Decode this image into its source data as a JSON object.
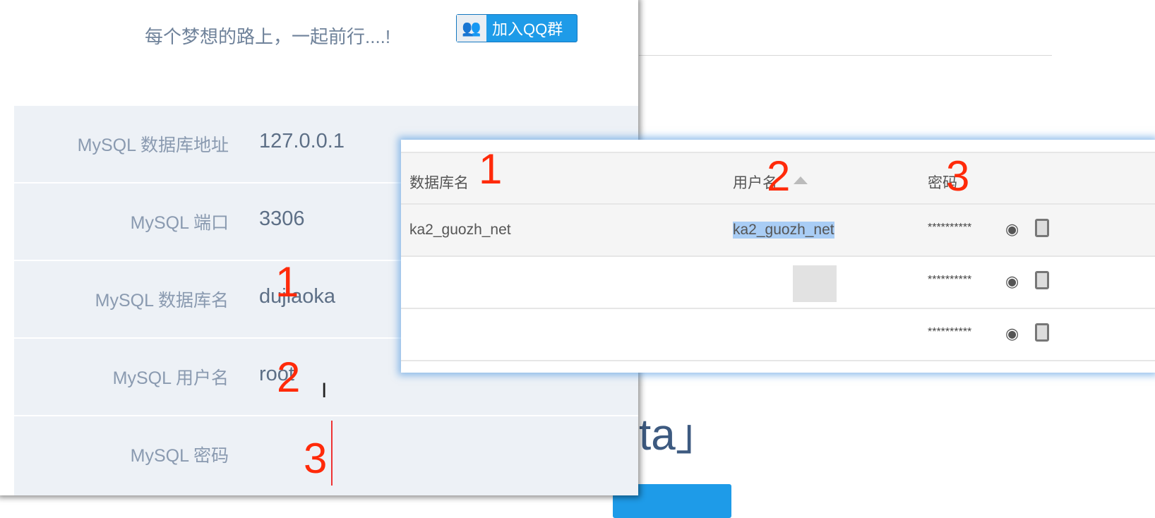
{
  "background": {
    "partial_heading": "ta」"
  },
  "header": {
    "slogan": "每个梦想的路上，一起前行....!",
    "qq_button": "加入QQ群"
  },
  "form": {
    "rows": [
      {
        "label": "MySQL 数据库地址",
        "value": "127.0.0.1"
      },
      {
        "label": "MySQL 端口",
        "value": "3306"
      },
      {
        "label": "MySQL 数据库名",
        "value": "dujiaoka"
      },
      {
        "label": "MySQL 用户名",
        "value": "root"
      },
      {
        "label": "MySQL 密码",
        "value": ""
      }
    ]
  },
  "annotations": {
    "one": "1",
    "two": "2",
    "three": "3"
  },
  "table": {
    "headers": [
      "数据库名",
      "用户名",
      "密码"
    ],
    "rows": [
      {
        "db": "ka2_guozh_net",
        "user": "ka2_guozh_net",
        "password": "**********"
      },
      {
        "db": "",
        "user": "",
        "password": "**********"
      },
      {
        "db": "",
        "user": "",
        "password": "**********"
      }
    ]
  },
  "colors": {
    "accent": "#1e9be8",
    "annotation": "#ff2a0a",
    "selection": "#a9cdf5"
  }
}
